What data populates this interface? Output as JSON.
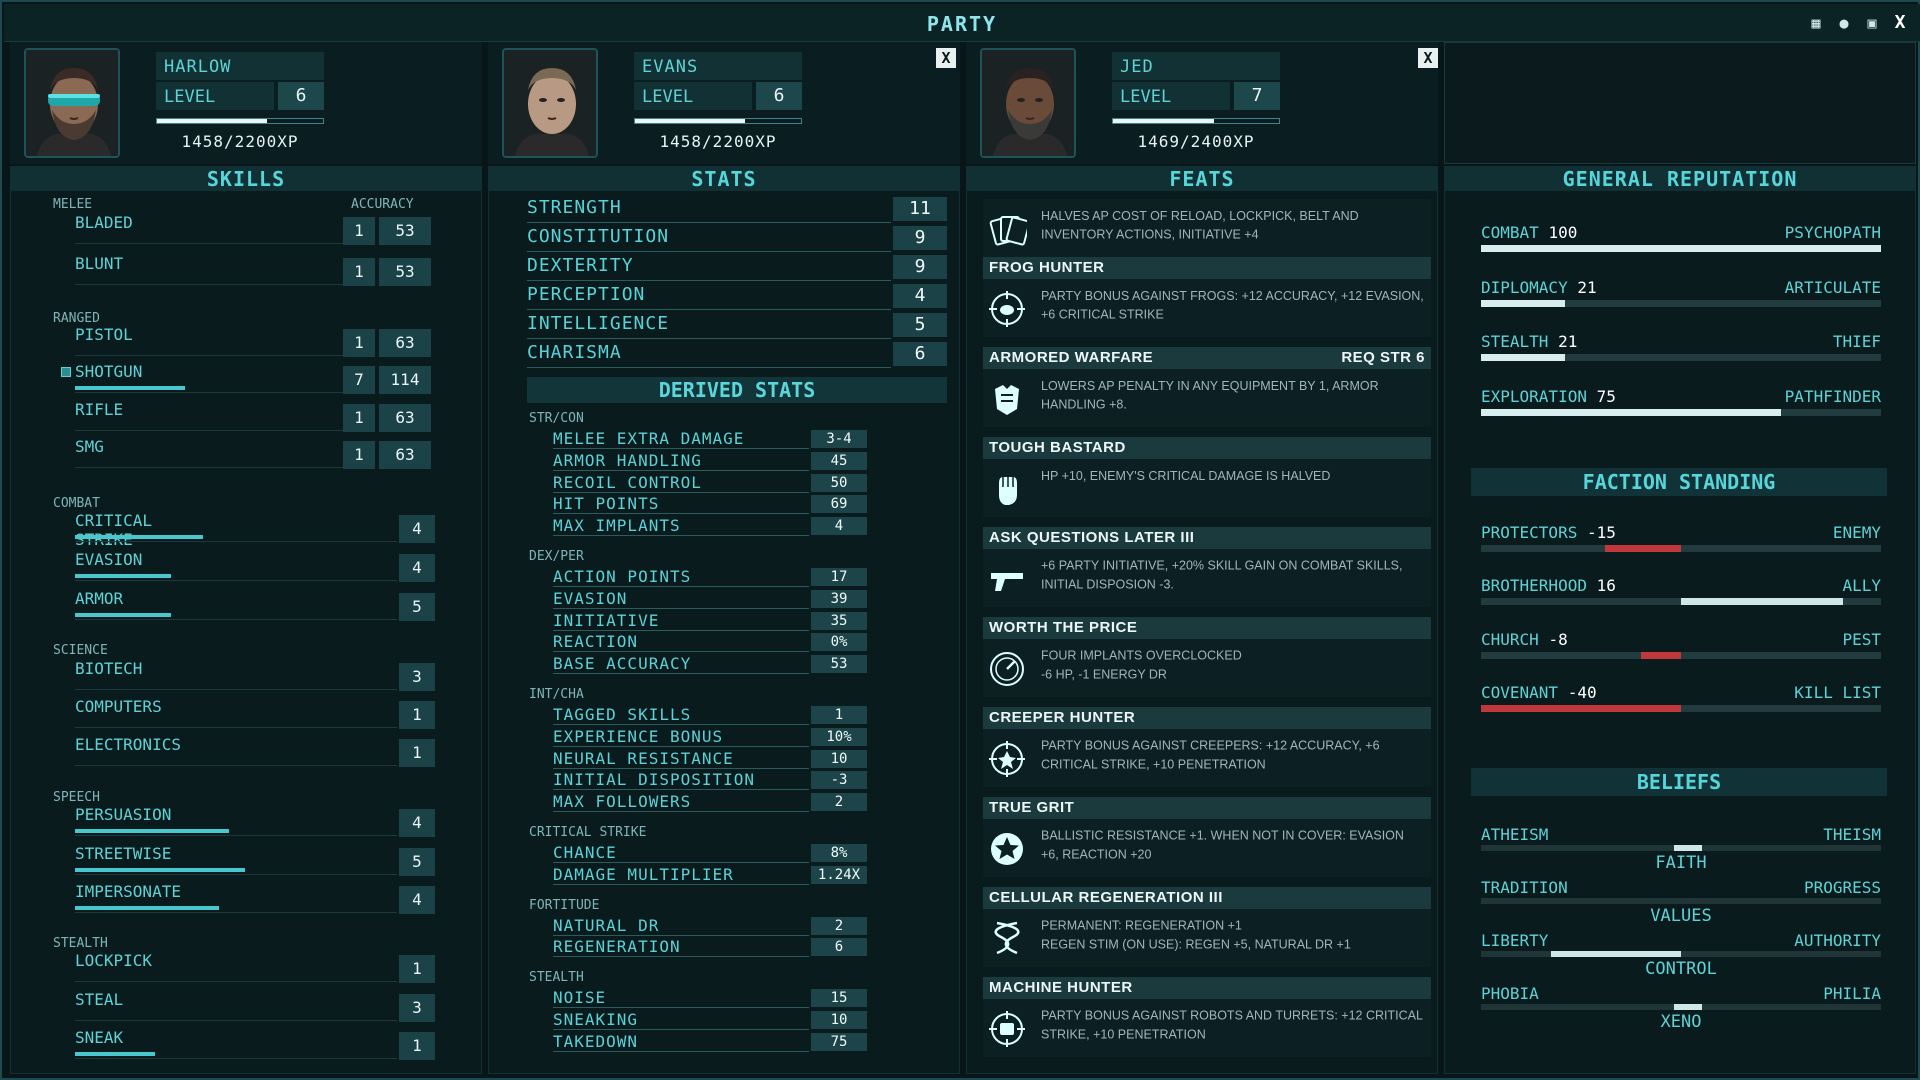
{
  "window": {
    "title": "PARTY"
  },
  "party": [
    {
      "name": "HARLOW",
      "level_label": "LEVEL",
      "level": "6",
      "xp": "1458/2200XP",
      "xp_fraction": 0.66
    },
    {
      "name": "EVANS",
      "level_label": "LEVEL",
      "level": "6",
      "xp": "1458/2200XP",
      "xp_fraction": 0.66,
      "close": "X"
    },
    {
      "name": "JED",
      "level_label": "LEVEL",
      "level": "7",
      "xp": "1469/2400XP",
      "xp_fraction": 0.61,
      "close": "X"
    }
  ],
  "skills": {
    "title": "SKILLS",
    "accuracy_label": "ACCURACY",
    "melee": {
      "label": "MELEE",
      "items": [
        {
          "name": "BLADED",
          "rank": "1",
          "acc": "53"
        },
        {
          "name": "BLUNT",
          "rank": "1",
          "acc": "53"
        }
      ]
    },
    "ranged": {
      "label": "RANGED",
      "items": [
        {
          "name": "PISTOL",
          "rank": "1",
          "acc": "63"
        },
        {
          "name": "SHOTGUN",
          "rank": "7",
          "acc": "114",
          "fill": 0.5
        },
        {
          "name": "RIFLE",
          "rank": "1",
          "acc": "63"
        },
        {
          "name": "SMG",
          "rank": "1",
          "acc": "63"
        }
      ]
    },
    "combat": {
      "label": "COMBAT",
      "items": [
        {
          "name": "CRITICAL STRIKE",
          "value": "4",
          "fill": 0.4
        },
        {
          "name": "EVASION",
          "value": "4",
          "fill": 0.3
        },
        {
          "name": "ARMOR",
          "value": "5",
          "fill": 0.3
        }
      ]
    },
    "science": {
      "label": "SCIENCE",
      "items": [
        {
          "name": "BIOTECH",
          "value": "3"
        },
        {
          "name": "COMPUTERS",
          "value": "1"
        },
        {
          "name": "ELECTRONICS",
          "value": "1"
        }
      ]
    },
    "speech": {
      "label": "SPEECH",
      "items": [
        {
          "name": "PERSUASION",
          "value": "4",
          "fill": 0.48
        },
        {
          "name": "STREETWISE",
          "value": "5",
          "fill": 0.53
        },
        {
          "name": "IMPERSONATE",
          "value": "4",
          "fill": 0.45
        }
      ]
    },
    "stealth": {
      "label": "STEALTH",
      "items": [
        {
          "name": "LOCKPICK",
          "value": "1"
        },
        {
          "name": "STEAL",
          "value": "3"
        },
        {
          "name": "SNEAK",
          "value": "1",
          "fill": 0.25
        }
      ]
    }
  },
  "stats": {
    "title": "STATS",
    "base": [
      {
        "name": "STRENGTH",
        "value": "11"
      },
      {
        "name": "CONSTITUTION",
        "value": "9"
      },
      {
        "name": "DEXTERITY",
        "value": "9"
      },
      {
        "name": "PERCEPTION",
        "value": "4"
      },
      {
        "name": "INTELLIGENCE",
        "value": "5"
      },
      {
        "name": "CHARISMA",
        "value": "6"
      }
    ],
    "derived_title": "DERIVED STATS",
    "groups": [
      {
        "label": "STR/CON",
        "rows": [
          {
            "name": "MELEE EXTRA DAMAGE",
            "value": "3-4"
          },
          {
            "name": "ARMOR HANDLING",
            "value": "45"
          },
          {
            "name": "RECOIL CONTROL",
            "value": "50"
          },
          {
            "name": "HIT POINTS",
            "value": "69"
          },
          {
            "name": "MAX IMPLANTS",
            "value": "4"
          }
        ]
      },
      {
        "label": "DEX/PER",
        "rows": [
          {
            "name": "ACTION POINTS",
            "value": "17"
          },
          {
            "name": "EVASION",
            "value": "39"
          },
          {
            "name": "INITIATIVE",
            "value": "35"
          },
          {
            "name": "REACTION",
            "value": "0%"
          },
          {
            "name": "BASE ACCURACY",
            "value": "53"
          }
        ]
      },
      {
        "label": "INT/CHA",
        "rows": [
          {
            "name": "TAGGED SKILLS",
            "value": "1"
          },
          {
            "name": "EXPERIENCE BONUS",
            "value": "10%"
          },
          {
            "name": "NEURAL RESISTANCE",
            "value": "10"
          },
          {
            "name": "INITIAL DISPOSITION",
            "value": "-3"
          },
          {
            "name": "MAX FOLLOWERS",
            "value": "2"
          }
        ]
      },
      {
        "label": "CRITICAL STRIKE",
        "rows": [
          {
            "name": "CHANCE",
            "value": "8%"
          },
          {
            "name": "DAMAGE MULTIPLIER",
            "value": "1.24X"
          }
        ]
      },
      {
        "label": "FORTITUDE",
        "rows": [
          {
            "name": "NATURAL DR",
            "value": "2"
          },
          {
            "name": "REGENERATION",
            "value": "6"
          }
        ]
      },
      {
        "label": "STEALTH",
        "rows": [
          {
            "name": "NOISE",
            "value": "15"
          },
          {
            "name": "SNEAKING",
            "value": "10"
          },
          {
            "name": "TAKEDOWN",
            "value": "75"
          }
        ]
      }
    ]
  },
  "feats": {
    "title": "FEATS",
    "items": [
      {
        "name": "",
        "req": "",
        "icon": "cards-icon",
        "desc": "HALVES AP COST OF RELOAD, LOCKPICK, BELT AND INVENTORY ACTIONS, INITIATIVE +4"
      },
      {
        "name": "FROG HUNTER",
        "req": "",
        "icon": "frog-target-icon",
        "desc": "PARTY BONUS AGAINST FROGS: +12 ACCURACY, +12 EVASION, +6 CRITICAL STRIKE"
      },
      {
        "name": "ARMORED WARFARE",
        "req": "REQ STR 6",
        "icon": "armor-icon",
        "desc": "LOWERS AP PENALTY IN ANY EQUIPMENT BY 1, ARMOR HANDLING +8."
      },
      {
        "name": "TOUGH BASTARD",
        "req": "",
        "icon": "fist-icon",
        "desc": "HP +10, ENEMY'S CRITICAL DAMAGE IS HALVED"
      },
      {
        "name": "ASK QUESTIONS LATER III",
        "req": "",
        "icon": "pistol-icon",
        "desc": "+6 PARTY INITIATIVE, +20% SKILL GAIN ON COMBAT SKILLS, INITIAL DISPOSION -3."
      },
      {
        "name": "WORTH THE PRICE",
        "req": "",
        "icon": "gauge-icon",
        "desc": "FOUR IMPLANTS OVERCLOCKED\n-6 HP, -1 ENERGY DR"
      },
      {
        "name": "CREEPER HUNTER",
        "req": "",
        "icon": "creeper-target-icon",
        "desc": "PARTY BONUS AGAINST CREEPERS: +12 ACCURACY, +6 CRITICAL STRIKE, +10 PENETRATION"
      },
      {
        "name": "TRUE GRIT",
        "req": "",
        "icon": "star-badge-icon",
        "desc": "BALLISTIC RESISTANCE +1. WHEN NOT IN COVER: EVASION +6, REACTION +20"
      },
      {
        "name": "CELLULAR REGENERATION III",
        "req": "",
        "icon": "dna-icon",
        "desc": "PERMANENT: REGENERATION +1\nREGEN STIM (ON USE): REGEN +5, NATURAL DR +1"
      },
      {
        "name": "MACHINE HUNTER",
        "req": "",
        "icon": "robot-target-icon",
        "desc": "PARTY BONUS AGAINST ROBOTS AND TURRETS: +12 CRITICAL STRIKE, +10 PENETRATION"
      }
    ]
  },
  "reputation": {
    "title": "GENERAL REPUTATION",
    "items": [
      {
        "name": "COMBAT",
        "value": "100",
        "rank": "PSYCHOPATH",
        "fill": 1.0
      },
      {
        "name": "DIPLOMACY",
        "value": "21",
        "rank": "ARTICULATE",
        "fill": 0.21
      },
      {
        "name": "STEALTH",
        "value": "21",
        "rank": "THIEF",
        "fill": 0.21
      },
      {
        "name": "EXPLORATION",
        "value": "75",
        "rank": "PATHFINDER",
        "fill": 0.75
      }
    ],
    "faction_title": "FACTION STANDING",
    "factions": [
      {
        "name": "PROTECTORS",
        "value": "-15",
        "rank": "ENEMY",
        "level": -0.38
      },
      {
        "name": "BROTHERHOOD",
        "value": "16",
        "rank": "ALLY",
        "level": 0.81
      },
      {
        "name": "CHURCH",
        "value": "-8",
        "rank": "PEST",
        "level": -0.2
      },
      {
        "name": "COVENANT",
        "value": "-40",
        "rank": "KILL LIST",
        "level": -1.0
      }
    ],
    "beliefs_title": "BELIEFS",
    "beliefs": [
      {
        "left": "ATHEISM",
        "right": "THEISM",
        "axis": "FAITH",
        "level": 0.07
      },
      {
        "left": "TRADITION",
        "right": "PROGRESS",
        "axis": "VALUES",
        "level": 0.0
      },
      {
        "left": "LIBERTY",
        "right": "AUTHORITY",
        "axis": "CONTROL",
        "level": -0.65
      },
      {
        "left": "PHOBIA",
        "right": "PHILIA",
        "axis": "XENO",
        "level": 0.07
      }
    ]
  }
}
